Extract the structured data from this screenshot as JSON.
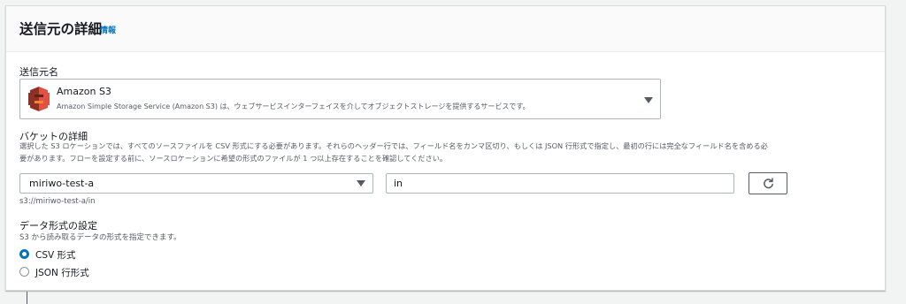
{
  "panel": {
    "title": "送信元の詳細",
    "info_link": "情報"
  },
  "source_name": {
    "label": "送信元名",
    "selected": {
      "title": "Amazon S3",
      "subtitle": "Amazon Simple Storage Service (Amazon S3) は、ウェブサービスインターフェイスを介してオブジェクトストレージを提供するサービスです。",
      "icon": "amazon-s3-icon"
    }
  },
  "bucket": {
    "label": "バケットの詳細",
    "description_line1": "選択した S3 ロケーションでは、すべてのソースファイルを CSV 形式にする必要があります。それらのヘッダー行では、フィールド名をカンマ区切り、もしくは JSON 行形式で指定し、最初の行には完全なフィールド名を含める必",
    "description_line2": "要があります。フローを設定する前に、ソースロケーションに希望の形式のファイルが 1 つ以上存在することを確認してください。",
    "bucket_name": "miriwo-test-a",
    "prefix_value": "in",
    "path_hint": "s3://miriwo-test-a/in"
  },
  "data_format": {
    "label": "データ形式の設定",
    "description": "S3 から読み取るデータの形式を指定できます。",
    "options": [
      {
        "label": "CSV 形式",
        "checked": true
      },
      {
        "label": "JSON 行形式",
        "checked": false
      }
    ]
  },
  "colors": {
    "accent": "#0073bb",
    "border": "#aab7b8",
    "text": "#16191f",
    "muted": "#545b64",
    "s3_red": "#c7382c"
  }
}
